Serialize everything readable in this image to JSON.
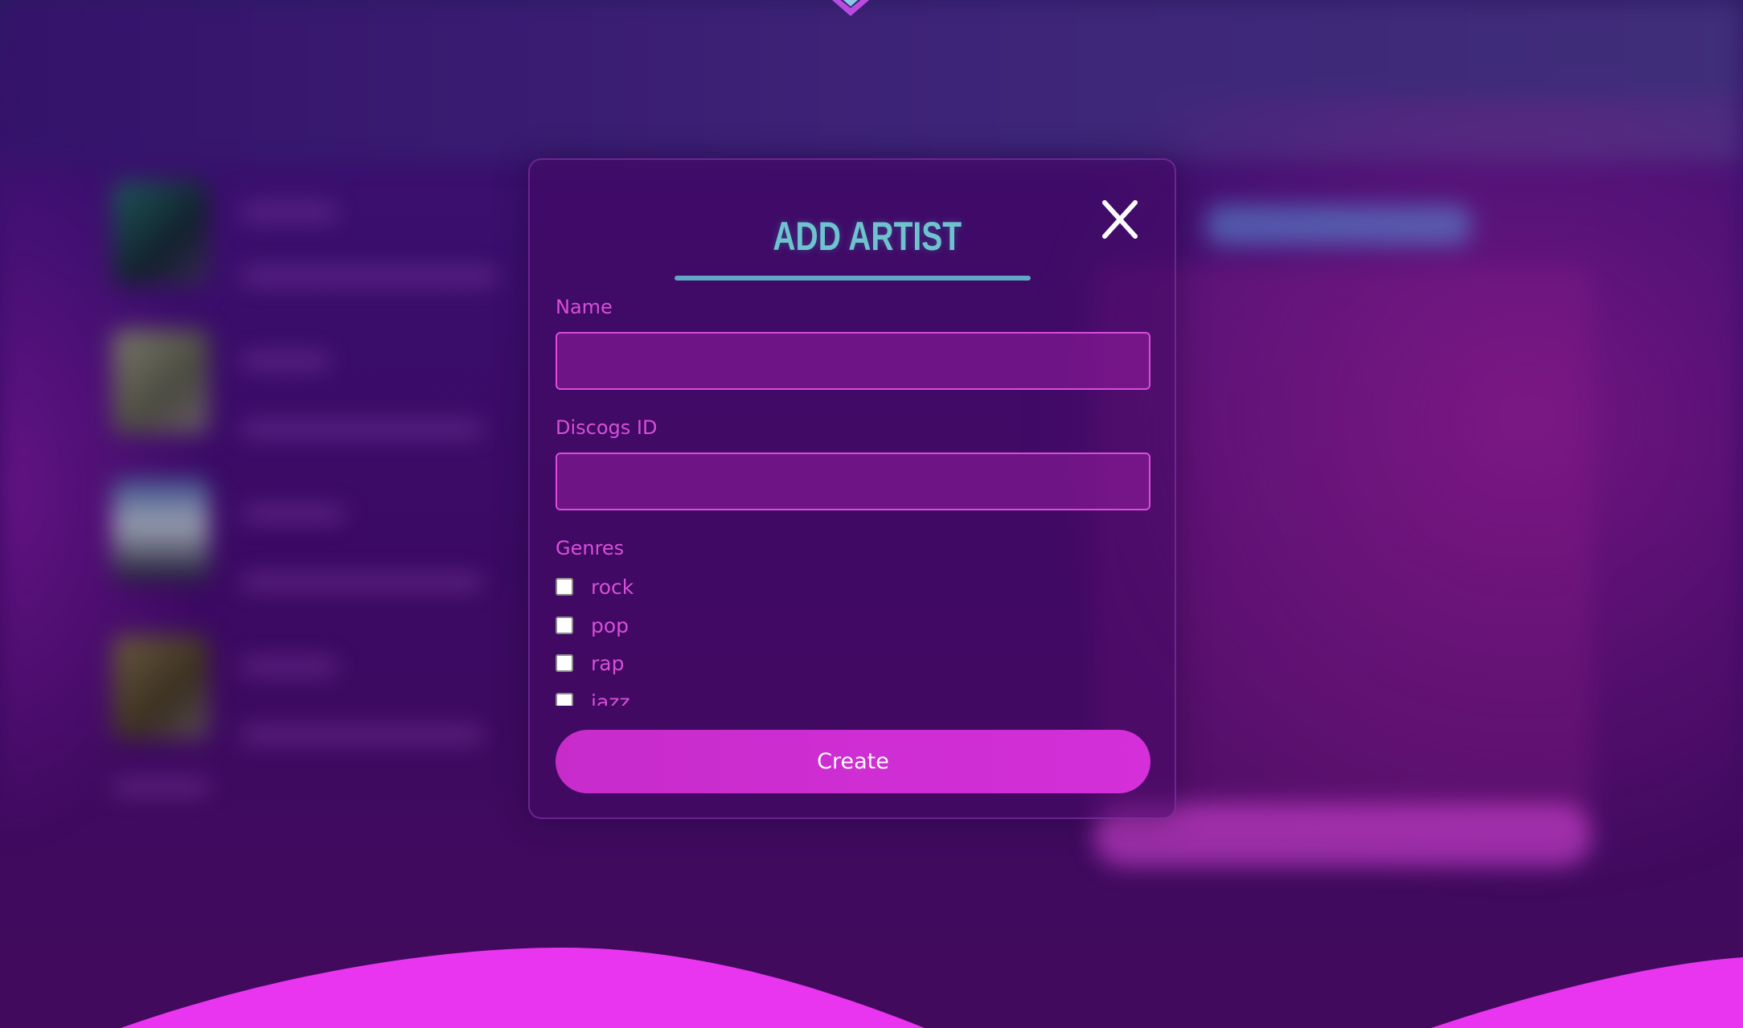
{
  "modal": {
    "title": "ADD ARTIST",
    "close_icon": "close-icon",
    "name_label": "Name",
    "name_value": "",
    "discogs_label": "Discogs ID",
    "discogs_value": "",
    "genres_label": "Genres",
    "genres": [
      {
        "label": "rock",
        "checked": false
      },
      {
        "label": "pop",
        "checked": false
      },
      {
        "label": "rap",
        "checked": false
      },
      {
        "label": "jazz",
        "checked": false
      }
    ],
    "create_label": "Create"
  },
  "colors": {
    "accent": "#d42fd9",
    "title": "#6fc3cf",
    "label": "#d84fd7",
    "wave": "#e935ef"
  }
}
